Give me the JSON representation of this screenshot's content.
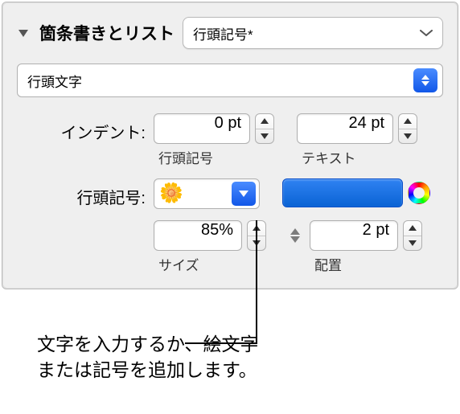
{
  "header": {
    "title": "箇条書きとリスト",
    "style_value": "行頭記号*"
  },
  "type_value": "行頭文字",
  "indent": {
    "label": "インデント:",
    "bullet": {
      "value": "0 pt",
      "sublabel": "行頭記号"
    },
    "text": {
      "value": "24 pt",
      "sublabel": "テキスト"
    }
  },
  "bullet": {
    "label": "行頭記号:",
    "emoji": "🌼",
    "color": "#0a63d4"
  },
  "size": {
    "value": "85%",
    "sublabel": "サイズ"
  },
  "align": {
    "value": "2 pt",
    "sublabel": "配置"
  },
  "callout": {
    "line1": "文字を入力するか、絵文字",
    "line2": "または記号を追加します。"
  }
}
